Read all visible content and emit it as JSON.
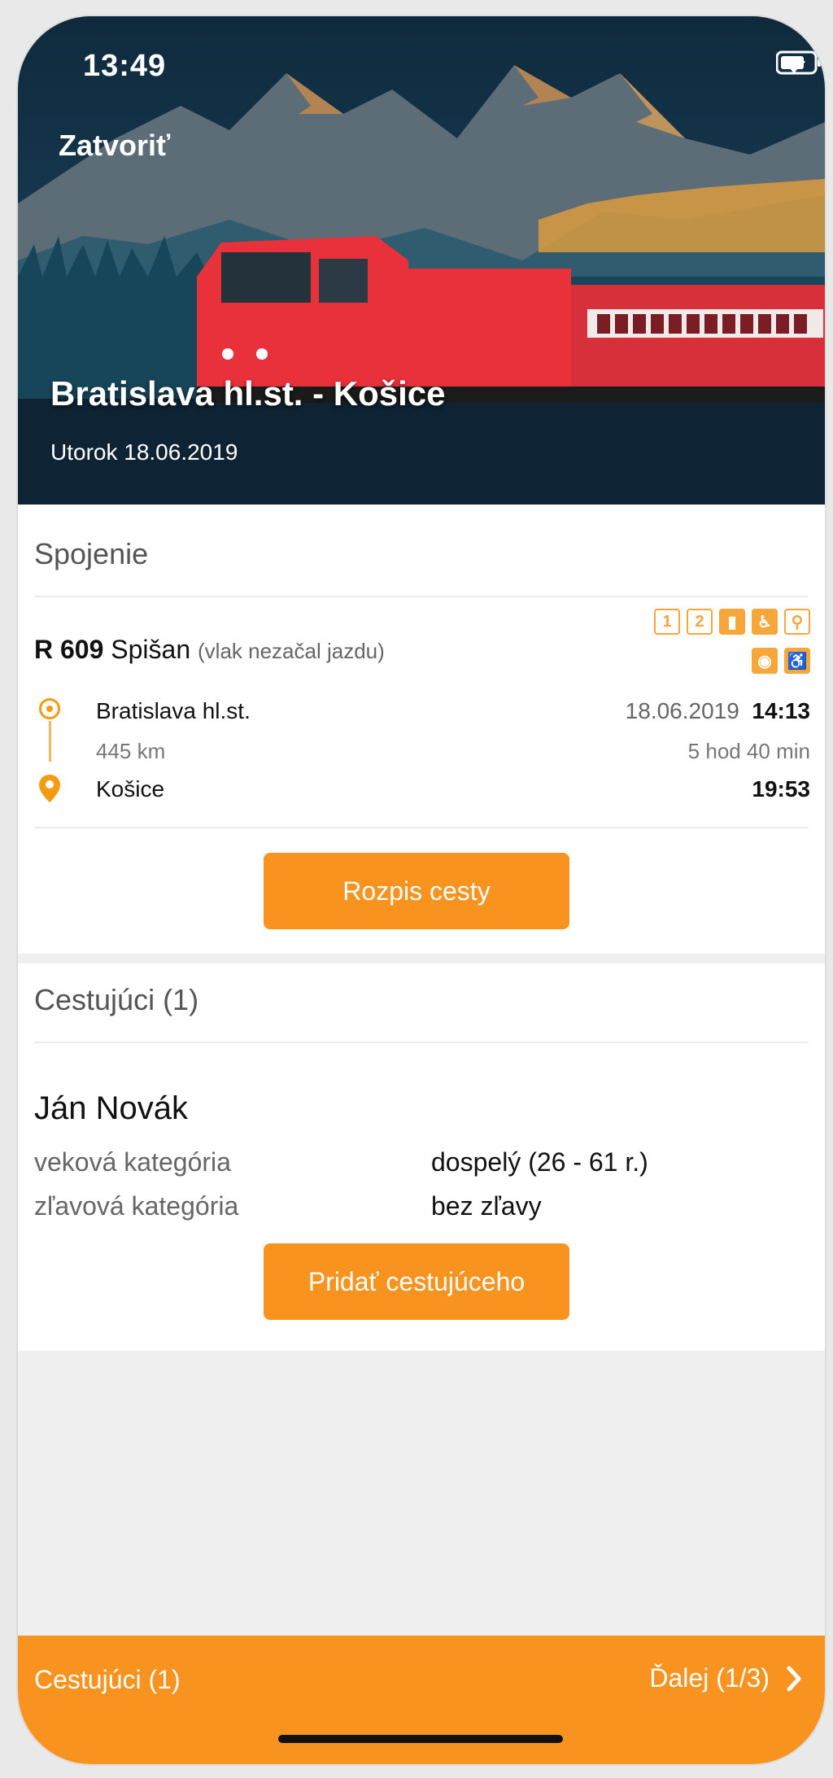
{
  "status_bar": {
    "time": "13:49"
  },
  "header": {
    "close_label": "Zatvoriť",
    "route": "Bratislava hl.st. - Košice",
    "date": "Utorok 18.06.2019"
  },
  "connection": {
    "section_title": "Spojenie",
    "train_code": "R 609",
    "train_name": "Spišan",
    "train_status": "(vlak nezačal jazdu)",
    "amenities": [
      "class-1-icon",
      "class-2-icon",
      "bed-icon",
      "seat-icon",
      "bike-icon",
      "wifi-icon",
      "wheelchair-icon"
    ],
    "amenity_labels": [
      "1",
      "2"
    ],
    "from": {
      "station": "Bratislava hl.st.",
      "date": "18.06.2019",
      "time": "14:13"
    },
    "distance": "445 km",
    "duration": "5 hod 40 min",
    "to": {
      "station": "Košice",
      "time": "19:53"
    },
    "details_button": "Rozpis cesty"
  },
  "passengers": {
    "section_title": "Cestujúci (1)",
    "name": "Ján Novák",
    "age_label": "veková kategória",
    "age_value": "dospelý (26 - 61 r.)",
    "discount_label": "zľavová kategória",
    "discount_value": "bez zľavy",
    "add_button": "Pridať cestujúceho"
  },
  "bottom_bar": {
    "left": "Cestujúci (1)",
    "right": "Ďalej (1/3)"
  },
  "colors": {
    "accent": "#f7931e",
    "hero_bg": "#18344a",
    "train": "#e8313b"
  }
}
